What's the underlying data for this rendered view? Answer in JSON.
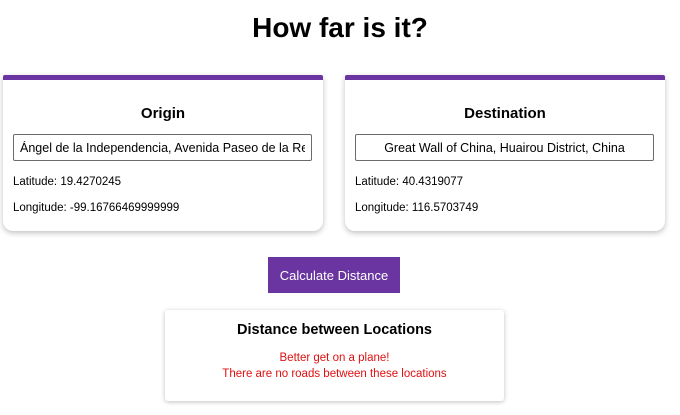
{
  "page": {
    "title": "How far is it?"
  },
  "origin": {
    "heading": "Origin",
    "input_value": "Ángel de la Independencia, Avenida Paseo de la Reforma, Juárez, Ciudad de México, CDMX, México",
    "latitude_label": "Latitude: 19.4270245",
    "longitude_label": "Longitude: -99.16766469999999"
  },
  "destination": {
    "heading": "Destination",
    "input_value": "Great Wall of China, Huairou District, China",
    "latitude_label": "Latitude: 40.4319077",
    "longitude_label": "Longitude: 116.5703749"
  },
  "actions": {
    "calculate_label": "Calculate Distance"
  },
  "result": {
    "heading": "Distance between Locations",
    "message_line1": "Better get on a plane!",
    "message_line2": "There are no roads between these locations"
  },
  "colors": {
    "accent": "#6a35a0",
    "error": "#e01010"
  }
}
